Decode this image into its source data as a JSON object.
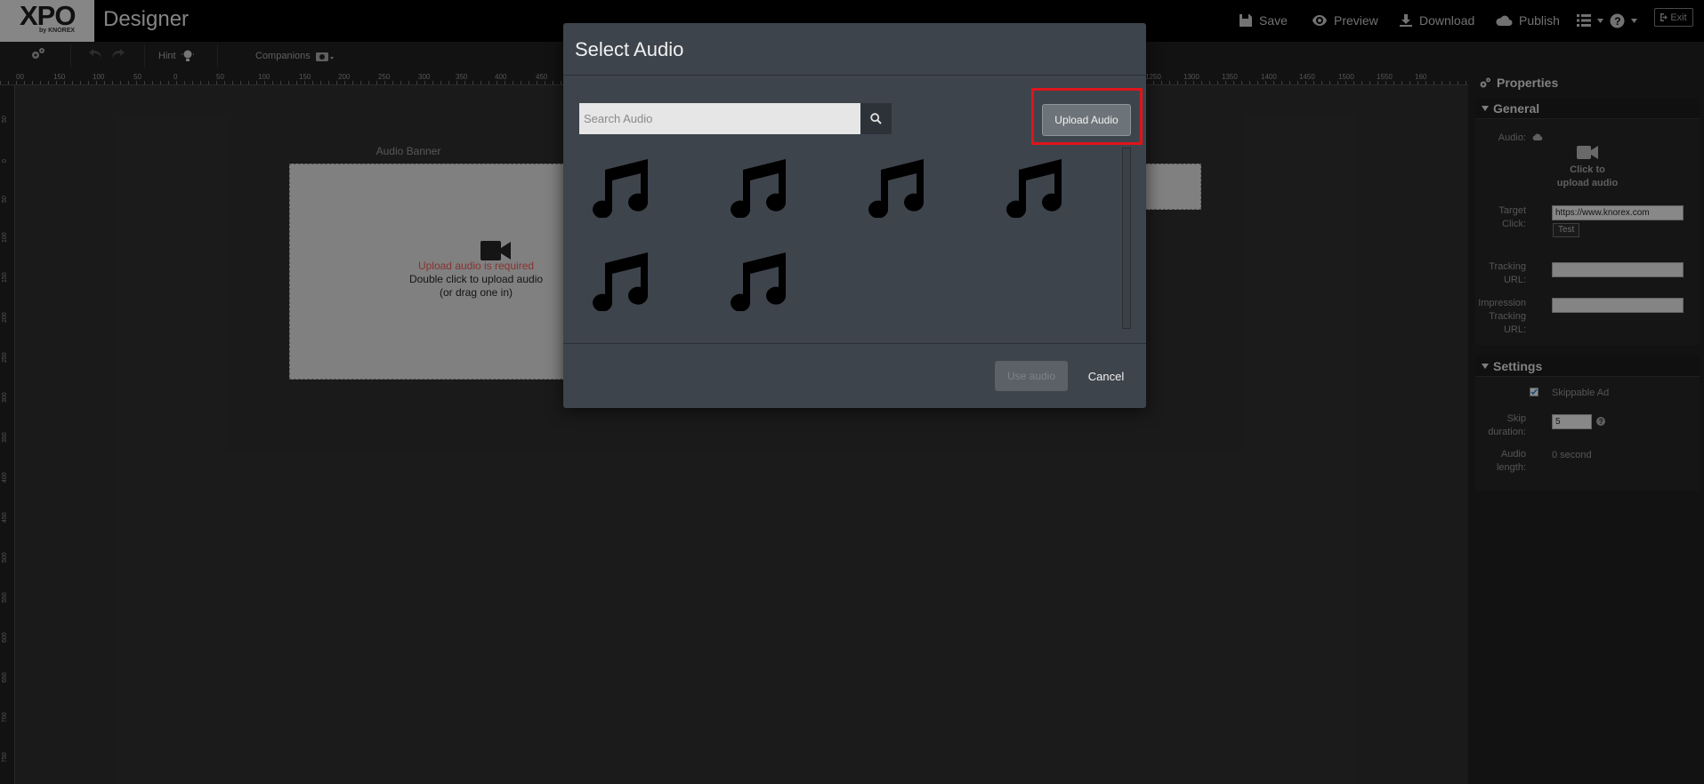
{
  "app": {
    "logo_text": "XPO",
    "logo_sub": "by KNOREX",
    "title": "Designer",
    "actions": [
      {
        "label": "Save",
        "icon": "save-icon"
      },
      {
        "label": "Preview",
        "icon": "eye-icon"
      },
      {
        "label": "Download",
        "icon": "download-icon"
      },
      {
        "label": "Publish",
        "icon": "cloud-icon"
      }
    ],
    "exit_label": "Exit"
  },
  "toolbar": {
    "hint_label": "Hint",
    "companions_label": "Companions"
  },
  "ruler": {
    "top_ticks": [
      "00",
      "150",
      "100",
      "50",
      "0",
      "50",
      "100",
      "150",
      "200",
      "250",
      "300",
      "350",
      "400",
      "450",
      "1250",
      "1300",
      "1350",
      "1400",
      "1450",
      "1500",
      "1550",
      "160"
    ],
    "left_ticks": [
      "50",
      "0",
      "50",
      "100",
      "150",
      "200",
      "250",
      "300",
      "350",
      "400",
      "450",
      "500",
      "550",
      "600",
      "650",
      "700",
      "750"
    ]
  },
  "canvas": {
    "banner_label": "Audio Banner",
    "error_text": "Upload audio is required",
    "hint_line1": "Double click to upload audio",
    "hint_line2": "(or drag one in)"
  },
  "properties": {
    "title": "Properties",
    "general": {
      "title": "General",
      "audio_label": "Audio:",
      "upload_hint": "Click to upload audio",
      "target_click_label": "Target Click:",
      "target_click_value": "https://www.knorex.com",
      "test_label": "Test",
      "tracking_label": "Tracking URL:",
      "tracking_value": "",
      "impression_label": "Impression Tracking URL:",
      "impression_value": ""
    },
    "settings": {
      "title": "Settings",
      "skippable_label": "Skippable Ad",
      "skippable_checked": true,
      "skip_duration_label": "Skip duration:",
      "skip_duration_value": "5",
      "audio_length_label": "Audio length:",
      "audio_length_value": "0 second"
    }
  },
  "modal": {
    "title": "Select Audio",
    "search_placeholder": "Search Audio",
    "upload_label": "Upload Audio",
    "audio_items": [
      "audio-1",
      "audio-2",
      "audio-3",
      "audio-4",
      "audio-5",
      "audio-6"
    ],
    "use_label": "Use audio",
    "cancel_label": "Cancel"
  },
  "colors": {
    "accent_highlight": "#e0141b",
    "error_text": "#d9534f",
    "modal_bg": "#3e444c"
  }
}
